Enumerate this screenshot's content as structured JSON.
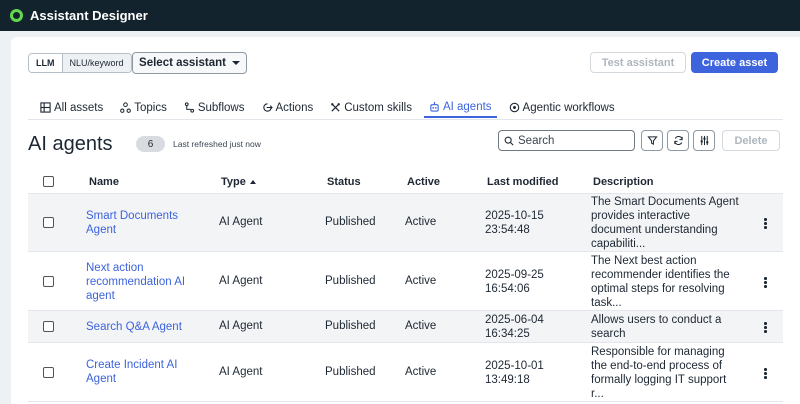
{
  "app": {
    "title": "Assistant Designer"
  },
  "toolbar": {
    "mode_llm": "LLM",
    "mode_nlu": "NLU/keyword",
    "select_assistant": "Select assistant",
    "test_assistant": "Test assistant",
    "create_asset": "Create asset"
  },
  "tabs": [
    {
      "label": "All assets",
      "icon": "grid-icon"
    },
    {
      "label": "Topics",
      "icon": "topics-icon"
    },
    {
      "label": "Subflows",
      "icon": "subflow-icon"
    },
    {
      "label": "Actions",
      "icon": "actions-icon"
    },
    {
      "label": "Custom skills",
      "icon": "tools-icon"
    },
    {
      "label": "AI agents",
      "icon": "robot-icon",
      "active": true
    },
    {
      "label": "Agentic workflows",
      "icon": "workflow-icon"
    }
  ],
  "header": {
    "title": "AI agents",
    "count": "6",
    "refreshed": "Last refreshed just now",
    "search_placeholder": "Search",
    "delete": "Delete"
  },
  "table": {
    "columns": {
      "name": "Name",
      "type": "Type",
      "status": "Status",
      "active": "Active",
      "modified": "Last modified",
      "description": "Description"
    },
    "rows": [
      {
        "name_line1": "Smart Documents",
        "name_line2": "Agent",
        "type": "AI Agent",
        "status": "Published",
        "active": "Active",
        "date": "2025-10-15",
        "time": "23:54:48",
        "desc": [
          "The Smart Documents Agent",
          "provides interactive",
          "document understanding",
          "capabiliti..."
        ]
      },
      {
        "name_line1": "Next action",
        "name_line2": "recommendation AI",
        "name_line3": "agent",
        "type": "AI Agent",
        "status": "Published",
        "active": "Active",
        "date": "2025-09-25",
        "time": "16:54:06",
        "desc": [
          "The Next best action",
          "recommender identifies the",
          "optimal steps for resolving",
          "task..."
        ]
      },
      {
        "name_line1": "Search Q&A Agent",
        "type": "AI Agent",
        "status": "Published",
        "active": "Active",
        "date": "2025-06-04",
        "time": "16:34:25",
        "desc": [
          "Allows users to conduct a",
          "search"
        ]
      },
      {
        "name_line1": "Create Incident AI",
        "name_line2": "Agent",
        "type": "AI Agent",
        "status": "Published",
        "active": "Active",
        "date": "2025-10-01",
        "time": "13:49:18",
        "desc": [
          "Responsible for managing",
          "the end-to-end process of",
          "formally logging IT support",
          "r..."
        ]
      }
    ]
  },
  "colors": {
    "accent": "#3d63dd",
    "topbar": "#12232e",
    "logo": "#62d84e"
  }
}
